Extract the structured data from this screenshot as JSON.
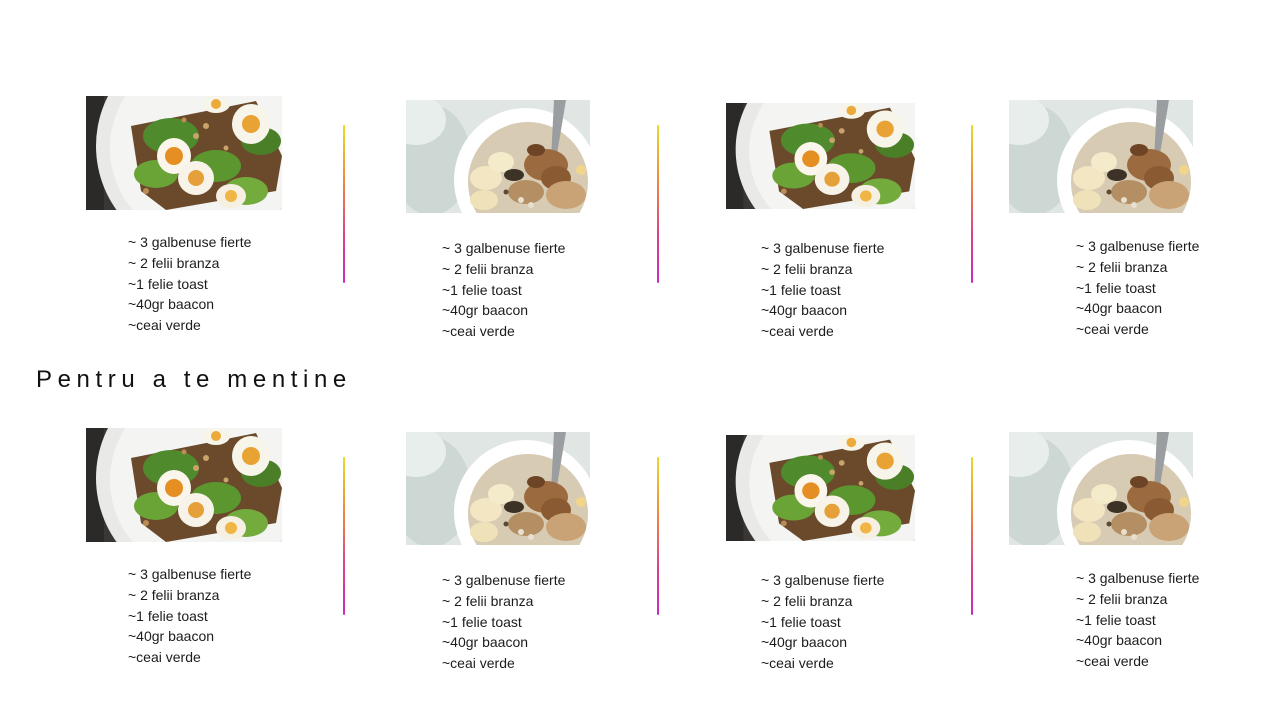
{
  "section_title": "Pentru a te mentine",
  "menu_items": [
    "~ 3 galbenuse fierte",
    "~ 2 felii branza",
    "~1 felie toast",
    "~40gr baacon",
    "~ceai verde"
  ],
  "image_types": [
    "egg-avocado-toast",
    "oatmeal-bowl",
    "egg-avocado-toast",
    "oatmeal-bowl",
    "egg-avocado-toast",
    "oatmeal-bowl",
    "egg-avocado-toast",
    "oatmeal-bowl"
  ],
  "colors": {
    "divider_top": "#e8dd28",
    "divider_bottom": "#c82bc2",
    "text": "#1c1c1c"
  }
}
